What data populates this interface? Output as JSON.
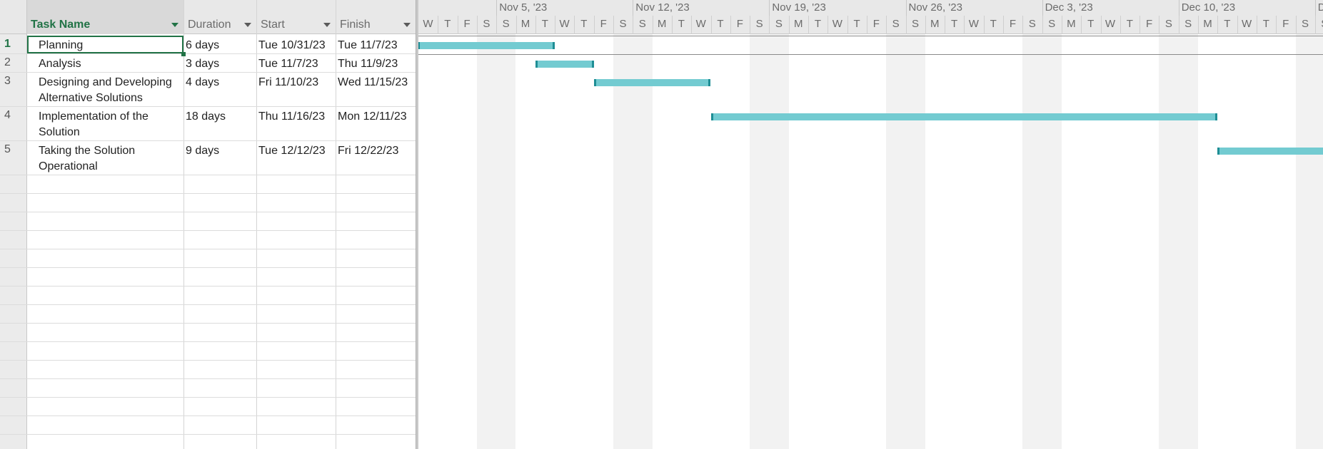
{
  "columns": {
    "task_name": "Task Name",
    "duration": "Duration",
    "start": "Start",
    "finish": "Finish"
  },
  "tasks": [
    {
      "id": "1",
      "name": "Planning",
      "duration": "6 days",
      "start": "Tue 10/31/23",
      "finish": "Tue 11/7/23"
    },
    {
      "id": "2",
      "name": "Analysis",
      "duration": "3 days",
      "start": "Tue 11/7/23",
      "finish": "Thu 11/9/23"
    },
    {
      "id": "3",
      "name": "Designing and Developing Alternative Solutions",
      "duration": "4 days",
      "start": "Fri 11/10/23",
      "finish": "Wed 11/15/23"
    },
    {
      "id": "4",
      "name": "Implementation of the Solution",
      "duration": "18 days",
      "start": "Thu 11/16/23",
      "finish": "Mon 12/11/23"
    },
    {
      "id": "5",
      "name": "Taking the Solution Operational",
      "duration": "9 days",
      "start": "Tue 12/12/23",
      "finish": "Fri 12/22/23"
    }
  ],
  "timescale": {
    "weeks": [
      "Nov 5, '23",
      "Nov 12, '23",
      "Nov 19, '23",
      "Nov 26, '23",
      "Dec 3, '23",
      "Dec 10, '23",
      "De"
    ],
    "days": [
      "W",
      "T",
      "F",
      "S",
      "S",
      "M",
      "T",
      "W",
      "T",
      "F",
      "S",
      "S",
      "M",
      "T",
      "W",
      "T",
      "F",
      "S",
      "S",
      "M",
      "T",
      "W",
      "T",
      "F",
      "S",
      "S",
      "M",
      "T",
      "W",
      "T",
      "F",
      "S",
      "S",
      "M",
      "T",
      "W",
      "T",
      "F",
      "S",
      "S",
      "M",
      "T",
      "W",
      "T",
      "F",
      "S",
      "S"
    ]
  },
  "colors": {
    "accent": "#217346",
    "bar": "#73cbd1",
    "bar_edge": "#1f8e95"
  }
}
